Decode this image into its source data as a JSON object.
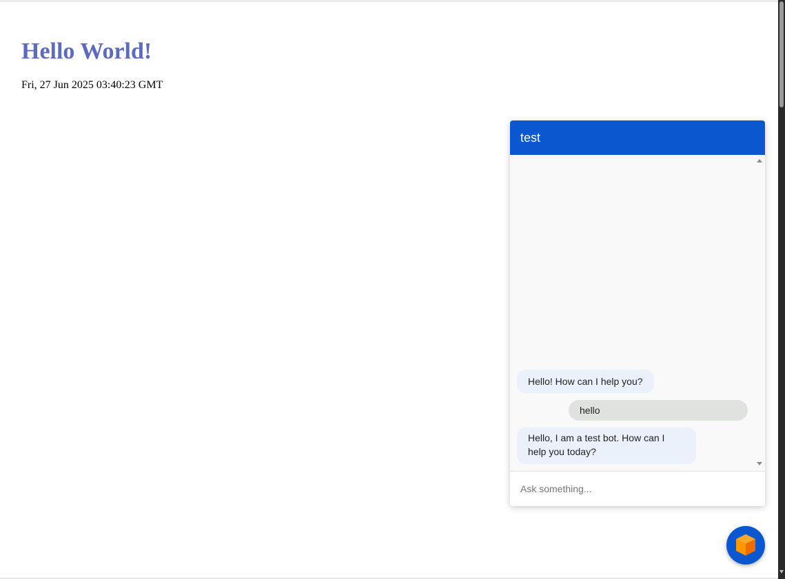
{
  "page": {
    "title": "Hello World!",
    "date": "Fri, 27 Jun 2025 03:40:23 GMT"
  },
  "chat": {
    "title": "test",
    "messages": [
      {
        "sender": "bot",
        "text": "Hello! How can I help you?"
      },
      {
        "sender": "user",
        "text": "hello"
      },
      {
        "sender": "bot",
        "text": "Hello, I am a test bot. How can I help you today?"
      }
    ],
    "input": {
      "placeholder": "Ask something...",
      "value": ""
    }
  },
  "launcher": {
    "icon": "cube-icon"
  },
  "colors": {
    "title": "#5c6bc0",
    "chat_header": "#0b57d0",
    "bot_bubble": "#eaf1fb",
    "user_bubble": "#e0e2e0",
    "launcher": "#0b57d0",
    "cube_orange": "#f57c00"
  }
}
